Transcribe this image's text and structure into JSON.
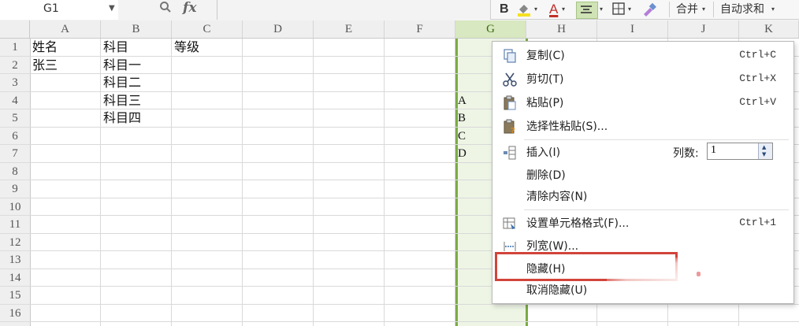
{
  "name_box": {
    "value": "G1"
  },
  "formula_bar": {
    "zoom_icon": "zoom-icon",
    "fx_label": "fx"
  },
  "toolbar": {
    "bold": "B",
    "font_color_label": "A",
    "merge_label": "合并",
    "autosum_label": "自动求和",
    "arrow": "▾"
  },
  "columns": [
    "A",
    "B",
    "C",
    "D",
    "E",
    "F",
    "G",
    "H",
    "I",
    "J",
    "K"
  ],
  "rows": [
    "1",
    "2",
    "3",
    "4",
    "5",
    "6",
    "7",
    "8",
    "9",
    "10",
    "11",
    "12",
    "13",
    "14",
    "15",
    "16"
  ],
  "cells": {
    "a1": "姓名",
    "b1": "科目",
    "c1": "等级",
    "a2": "张三",
    "b2": "科目一",
    "b3": "科目二",
    "b4": "科目三",
    "b5": "科目四",
    "g4": "A",
    "g5": "B",
    "g6": "C",
    "g7": "D"
  },
  "context_menu": {
    "copy": {
      "label": "复制(C)",
      "shortcut": "Ctrl+C"
    },
    "cut": {
      "label": "剪切(T)",
      "shortcut": "Ctrl+X"
    },
    "paste": {
      "label": "粘贴(P)",
      "shortcut": "Ctrl+V"
    },
    "paste_special": {
      "label": "选择性粘贴(S)..."
    },
    "insert": {
      "label": "插入(I)",
      "col_count_label": "列数:",
      "col_count_value": "1"
    },
    "delete": {
      "label": "删除(D)"
    },
    "clear": {
      "label": "清除内容(N)"
    },
    "format_cells": {
      "label": "设置单元格格式(F)...",
      "shortcut": "Ctrl+1"
    },
    "col_width": {
      "label": "列宽(W)..."
    },
    "hide": {
      "label": "隐藏(H)"
    },
    "unhide": {
      "label": "取消隐藏(U)"
    }
  },
  "colors": {
    "selection_green": "#7aab45",
    "highlight_red": "#d2443a",
    "selected_fill": "#eef5e5"
  }
}
